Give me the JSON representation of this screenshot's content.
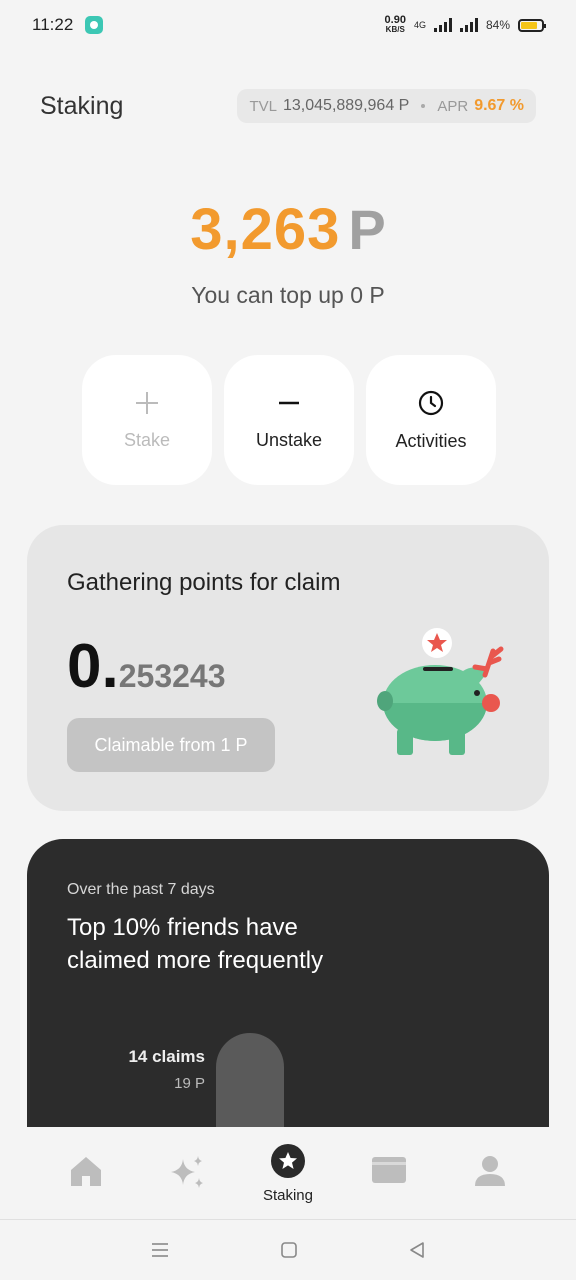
{
  "status_bar": {
    "time": "11:22",
    "net_speed_value": "0.90",
    "net_speed_unit": "KB/S",
    "network_type": "4G",
    "battery_percent": "84%"
  },
  "header": {
    "title": "Staking",
    "tvl_label": "TVL",
    "tvl_value": "13,045,889,964 P",
    "apr_label": "APR",
    "apr_value": "9.67 %"
  },
  "balance": {
    "amount": "3,263",
    "unit": "P",
    "topup_text": "You can top up 0 P"
  },
  "actions": [
    {
      "label": "Stake",
      "icon": "plus-icon",
      "enabled": false
    },
    {
      "label": "Unstake",
      "icon": "minus-icon",
      "enabled": true
    },
    {
      "label": "Activities",
      "icon": "clock-icon",
      "enabled": true
    }
  ],
  "claim_card": {
    "title": "Gathering points for claim",
    "value_int": "0.",
    "value_dec": "253243",
    "button_label": "Claimable from 1 P"
  },
  "friends_card": {
    "subtitle": "Over the past 7 days",
    "title": "Top 10% friends have claimed more frequently",
    "bar_claims": "14 claims",
    "bar_points": "19 P"
  },
  "bottom_nav": {
    "items": [
      {
        "name": "home-icon"
      },
      {
        "name": "sparkle-icon"
      },
      {
        "name": "star-circle-icon",
        "label": "Staking",
        "active": true
      },
      {
        "name": "wallet-icon"
      },
      {
        "name": "profile-icon"
      }
    ]
  },
  "colors": {
    "accent": "#f29a2e",
    "card_dark": "#2c2c2c",
    "piggy_green": "#6dc99a"
  }
}
